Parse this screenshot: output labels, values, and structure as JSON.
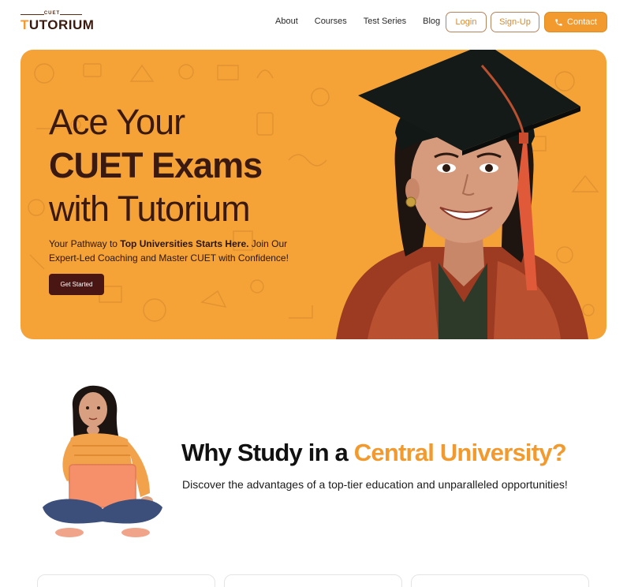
{
  "brand": {
    "tag": "CUET",
    "name": "TUTORIUM",
    "accent_color": "#f29a2e",
    "dark_color": "#3a1a0e"
  },
  "nav": {
    "links": [
      "About",
      "Courses",
      "Test Series",
      "Blog"
    ],
    "login_label": "Login",
    "signup_label": "Sign-Up",
    "contact_label": "Contact",
    "contact_icon": "phone-icon"
  },
  "hero": {
    "title_line1": "Ace Your",
    "title_line2": "CUET Exams",
    "title_line3": "with Tutorium",
    "subtitle_pre": "Your Pathway to ",
    "subtitle_bold": "Top Universities Starts Here.",
    "subtitle_post": " Join Our Expert-Led Coaching and Master CUET with Confidence!",
    "cta_label": "Get Started",
    "background_color": "#f5a237",
    "image": "graduate-student-photo"
  },
  "why": {
    "title_pre": "Why Study in a ",
    "title_accent": "Central University?",
    "subtitle": "Discover the advantages of a top-tier education and unparalleled opportunities!",
    "image": "student-with-laptop-photo"
  }
}
